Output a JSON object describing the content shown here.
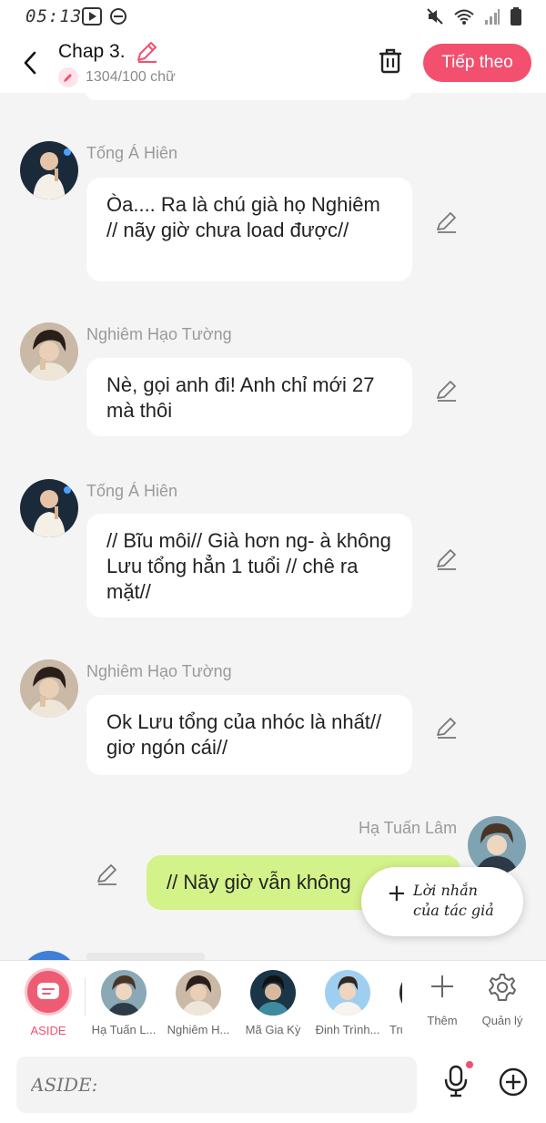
{
  "status_bar": {
    "time": "05:13"
  },
  "header": {
    "chapter_title": "Chap 3.",
    "word_count": "1304/100 chữ",
    "next_label": "Tiếp theo"
  },
  "messages": [
    {
      "sender": "Tống Á Hiên",
      "text": "Òa.... Ra là chú già họ Nghiêm // nãy giờ chưa load được//",
      "side": "left"
    },
    {
      "sender": "Nghiêm Hạo Tường",
      "text": "Nè, gọi anh đi! Anh chỉ mới 27 mà thôi",
      "side": "left"
    },
    {
      "sender": "Tống Á Hiên",
      "text": "// Bĩu môi// Già hơn ng- à không Lưu tổng hẳn 1 tuổi // chê ra mặt//",
      "side": "left"
    },
    {
      "sender": "Nghiêm Hạo Tường",
      "text": "Ok Lưu tổng của nhóc là nhất// giơ ngón cái//",
      "side": "left"
    },
    {
      "sender": "Hạ Tuấn Lâm",
      "text": "// Nãy giờ vẫn không",
      "side": "right"
    }
  ],
  "author_note": {
    "line1": "Lời nhắn",
    "line2": "của tác giả"
  },
  "character_bar": {
    "aside_label": "ASIDE",
    "characters": [
      "Hạ Tuấn L...",
      "Nghiêm H...",
      "Mã Gia Kỳ",
      "Đinh Trình...",
      "Trư"
    ],
    "add_label": "Thêm",
    "manage_label": "Quản lý"
  },
  "input": {
    "placeholder": "ASIDE:"
  },
  "colors": {
    "accent": "#f2506e",
    "right_bubble": "#d4f28a",
    "background": "#f4f4f4"
  }
}
